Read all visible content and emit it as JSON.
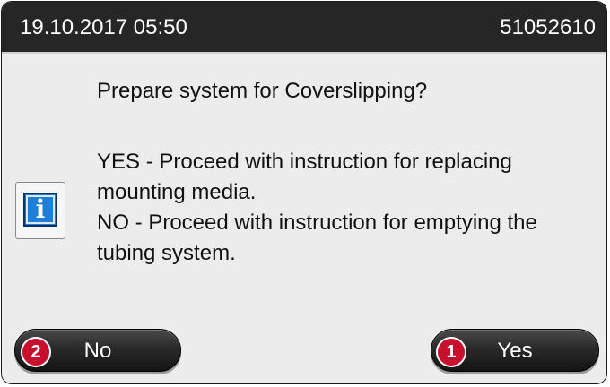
{
  "header": {
    "datetime": "19.10.2017 05:50",
    "serial": "51052610"
  },
  "dialog": {
    "question": "Prepare system for Coverslipping?",
    "lines": [
      "YES - Proceed with instruction for replacing",
      "mounting media.",
      "NO - Proceed with instruction for emptying the",
      "tubing system."
    ],
    "icon": "info-icon",
    "icon_glyph": "i"
  },
  "buttons": {
    "no_label": "No",
    "yes_label": "Yes"
  },
  "callouts": {
    "no_number": "2",
    "yes_number": "1",
    "color": "#c8102e"
  }
}
